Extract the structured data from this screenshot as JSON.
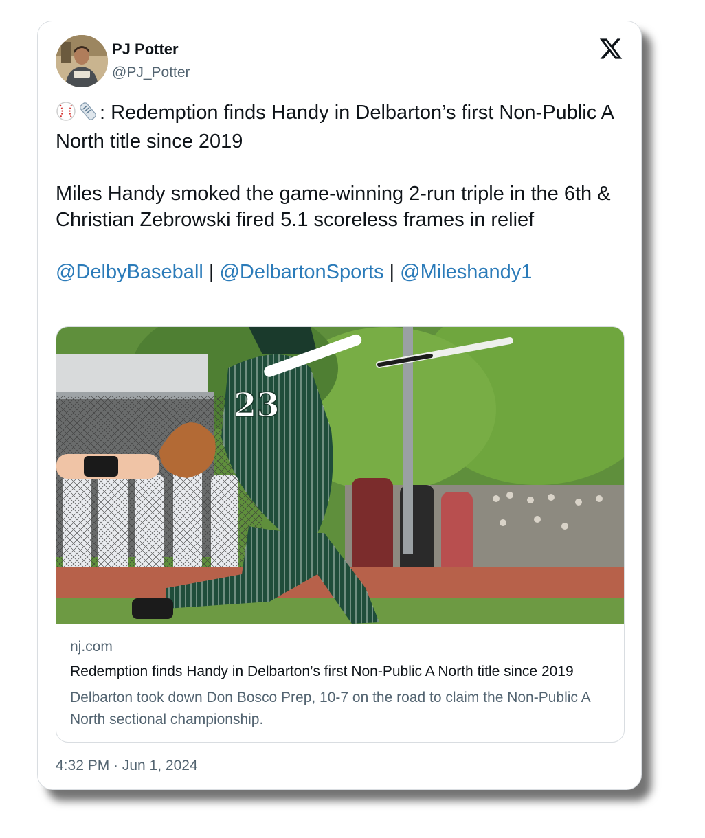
{
  "author": {
    "name": "PJ Potter",
    "handle": "@PJ_Potter"
  },
  "tweet": {
    "lead_emoji": "⚾📰",
    "line1": ": Redemption finds Handy in Delbarton’s first Non-Public A North title since 2019",
    "line2": "Miles Handy smoked the game-winning 2-run triple in the 6th & Christian Zebrowski fired 5.1 scoreless frames in relief",
    "mentions": [
      "@DelbyBaseball",
      "@DelbartonSports",
      "@Mileshandy1"
    ],
    "separator": " | "
  },
  "link_card": {
    "jersey_number": "23",
    "domain": "nj.com",
    "headline": "Redemption finds Handy in Delbarton’s first Non-Public A North title since 2019",
    "description": "Delbarton took down Don Bosco Prep, 10-7 on the road to claim the Non-Public A North sectional championship."
  },
  "timestamp": "4:32 PM · Jun 1, 2024",
  "colors": {
    "mention": "#2b7bb9",
    "text": "#0f1419",
    "secondary": "#536471",
    "jersey": "#1f4d3a"
  }
}
